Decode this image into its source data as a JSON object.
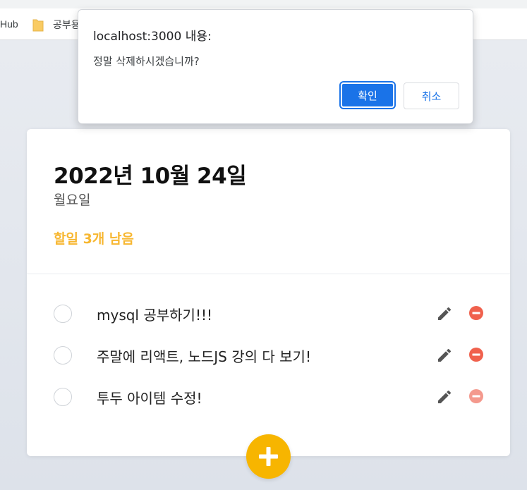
{
  "browser": {
    "bookmark_partial": "Hub",
    "folder_label": "공부용",
    "icons": {
      "folder": "folder-icon"
    }
  },
  "dialog": {
    "title": "localhost:3000 내용:",
    "message": "정말 삭제하시겠습니까?",
    "confirm_label": "확인",
    "cancel_label": "취소",
    "confirm_color": "#1a73e8"
  },
  "header": {
    "date": "2022년 10월 24일",
    "weekday": "월요일",
    "tasks_left": "할일 3개 남음",
    "accent_color": "#f7b731"
  },
  "todos": [
    {
      "text": "mysql 공부하기!!!",
      "done": false
    },
    {
      "text": "주말에 리액트, 노드JS 강의 다 보기!",
      "done": false
    },
    {
      "text": "투두 아이템 수정!",
      "done": false
    }
  ],
  "icons": {
    "edit": "pencil-icon",
    "remove": "remove-circle-icon",
    "add": "plus-icon"
  },
  "colors": {
    "remove": "#f0614d",
    "add_button": "#f7b500"
  }
}
